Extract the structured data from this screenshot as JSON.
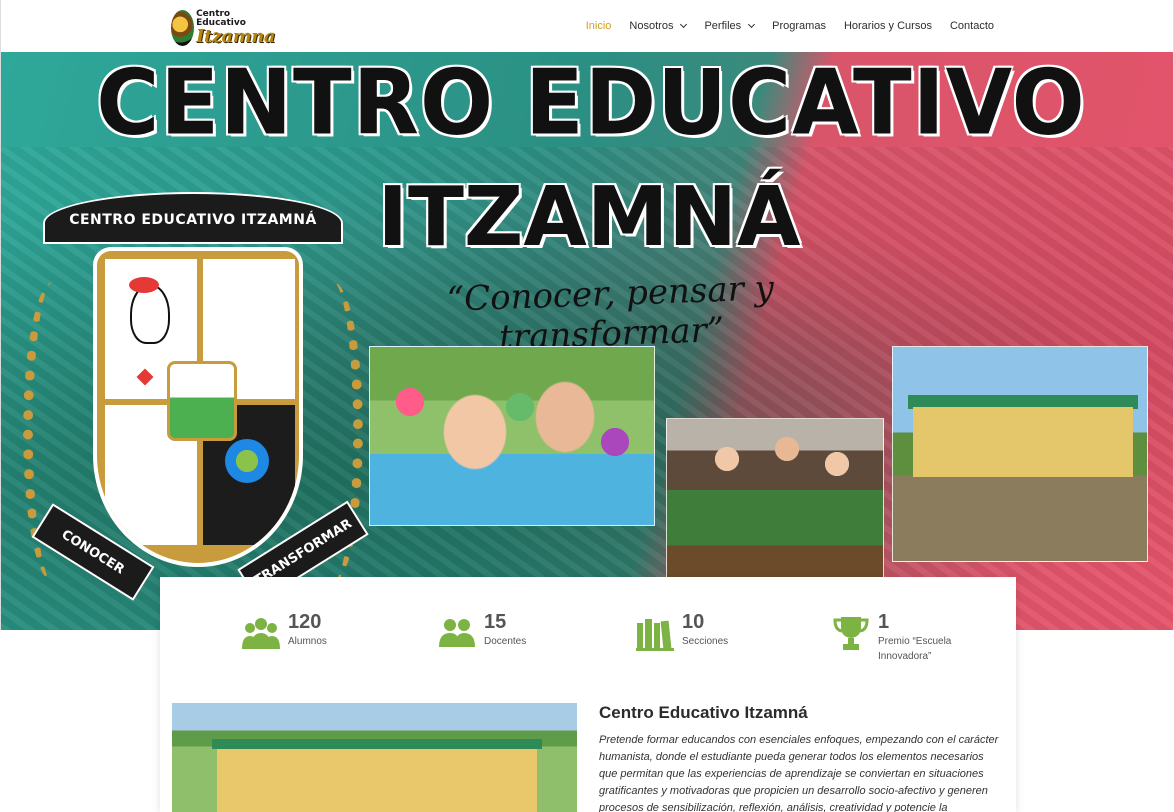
{
  "logo": {
    "line1": "Centro Educativo",
    "line2": "Itzamna"
  },
  "nav": {
    "items": [
      {
        "label": "Inicio",
        "active": true,
        "dropdown": false
      },
      {
        "label": "Nosotros",
        "active": false,
        "dropdown": true
      },
      {
        "label": "Perfiles",
        "active": false,
        "dropdown": true
      },
      {
        "label": "Programas",
        "active": false,
        "dropdown": false
      },
      {
        "label": "Horarios y Cursos",
        "active": false,
        "dropdown": false
      },
      {
        "label": "Contacto",
        "active": false,
        "dropdown": false
      }
    ]
  },
  "hero": {
    "title": "CENTRO EDUCATIVO",
    "subtitle": "ITZAMNÁ",
    "motto": "“Conocer, pensar y transformar”",
    "crest": {
      "ribbon_top": "CENTRO EDUCATIVO ITZAMNÁ",
      "ribbon_left": "CONOCER",
      "ribbon_right": "TRANSFORMAR"
    }
  },
  "stats": [
    {
      "icon": "users-group-icon",
      "number": "120",
      "label": "Alumnos"
    },
    {
      "icon": "teachers-icon",
      "number": "15",
      "label": "Docentes"
    },
    {
      "icon": "books-icon",
      "number": "10",
      "label": "Secciones"
    },
    {
      "icon": "trophy-icon",
      "number": "1",
      "label": "Premio “Escuela Innovadora”"
    }
  ],
  "about": {
    "title": "Centro Educativo Itzamná",
    "text": "Pretende formar educandos con esenciales enfoques, empezando con el carácter humanista, donde el estudiante pueda generar todos los elementos necesarios que permitan que las experiencias de aprendizaje se conviertan en situaciones gratificantes y motivadoras que propicien un desarrollo socio-afectivo y generen procesos de sensibilización, reflexión, análisis, creatividad y potencie la"
  },
  "colors": {
    "accent": "#d4a017",
    "icon_green": "#7cb342",
    "text": "#555555"
  }
}
